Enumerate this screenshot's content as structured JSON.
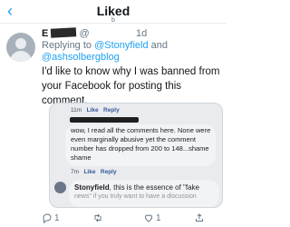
{
  "topbar": {
    "back_icon": "chevron-left-icon",
    "title": "Liked",
    "subtitle": "b"
  },
  "tweet": {
    "name": "E",
    "handle": "@",
    "time": "1d",
    "replying_prefix": "Replying to ",
    "mention_1": "@Stonyfield",
    "mention_joiner": " and",
    "mention_2": "@ashsolbergblog",
    "text": "I'd like to know why I was banned from your Facebook for posting this comment.",
    "actions": {
      "reply_count": "1",
      "retweet_count": "",
      "like_count": "1"
    }
  },
  "embedded_facebook": {
    "meta_1": {
      "time": "11m",
      "like": "Like",
      "reply": "Reply"
    },
    "comment": "wow, I read all the comments here. None were even marginally abusive yet the comment number has dropped from 200 to 148...shame shame",
    "meta_2": {
      "time": "7m",
      "like": "Like",
      "reply": "Reply"
    },
    "reply_author": "Stonyfield",
    "reply_text": ", this is the essence of \"fake",
    "reply_cut": "news\" if you truly want to have a discussion"
  },
  "colors": {
    "accent": "#1da1f2",
    "text": "#14171a",
    "muted": "#657786",
    "fb_bg": "#e9ebee"
  }
}
